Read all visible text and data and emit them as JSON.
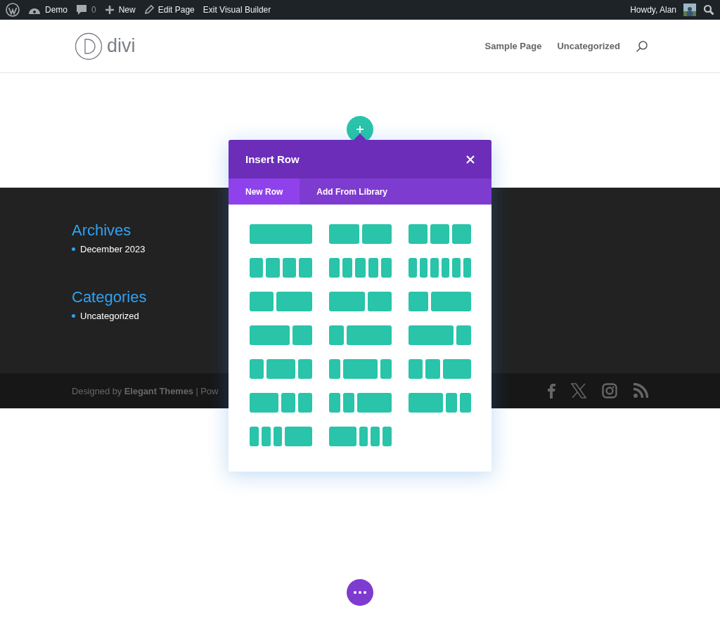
{
  "admin_bar": {
    "site": "Demo",
    "comments": "0",
    "new": "New",
    "edit": "Edit Page",
    "exit": "Exit Visual Builder",
    "greeting": "Howdy, Alan"
  },
  "header": {
    "logo_text": "divi",
    "nav": [
      "Sample Page",
      "Uncategorized"
    ]
  },
  "widgets": [
    {
      "title": "Archives",
      "items": [
        "December 2023"
      ]
    },
    {
      "title": "Categories",
      "items": [
        "Uncategorized"
      ]
    }
  ],
  "footer": {
    "credit": "Designed by **Elegant Themes** | Pow"
  },
  "modal": {
    "title": "Insert Row",
    "tabs": [
      {
        "label": "New Row",
        "selected": true
      },
      {
        "label": "Add From Library",
        "selected": false
      }
    ],
    "layouts": [
      {
        "kind": "full"
      },
      {
        "kind": "halves"
      },
      {
        "kind": "thirds"
      },
      {
        "kind": "quarters"
      },
      {
        "kind": "fifths"
      },
      {
        "kind": "sixths"
      },
      {
        "kind": "twofifths-threefifths"
      },
      {
        "kind": "threefifths-twofifths"
      },
      {
        "kind": "third-twothirds"
      },
      {
        "kind": "twothirds-third"
      },
      {
        "kind": "quarter-threequarters"
      },
      {
        "kind": "threequarters-quarter"
      },
      {
        "kind": "quarter-half-quarter"
      },
      {
        "kind": "fifth-threefifths-fifth"
      },
      {
        "kind": "quarter-quarter-half"
      },
      {
        "kind": "half-quarter-quarter"
      },
      {
        "kind": "fifth-fifth-threefifths"
      },
      {
        "kind": "threefifths-fifth-fifth"
      },
      {
        "kind": "sixth-sixth-sixth-half"
      },
      {
        "kind": "half-sixth-sixth-sixth"
      }
    ]
  }
}
